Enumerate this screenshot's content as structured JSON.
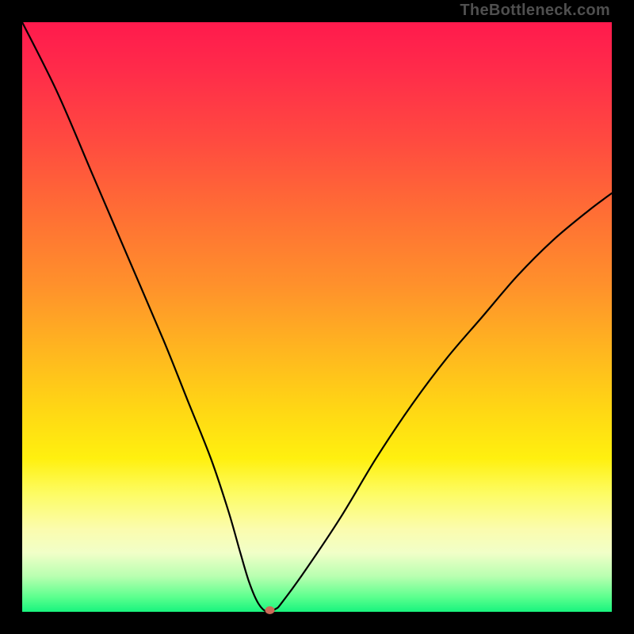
{
  "watermark": "TheBottleneck.com",
  "chart_data": {
    "type": "line",
    "title": "",
    "xlabel": "",
    "ylabel": "",
    "xlim": [
      0,
      100
    ],
    "ylim": [
      0,
      100
    ],
    "grid": false,
    "legend": false,
    "background_gradient": {
      "direction": "vertical",
      "stops": [
        {
          "pos": 0,
          "color": "#ff1a4d",
          "meaning": "bad-top"
        },
        {
          "pos": 50,
          "color": "#ffb71f",
          "meaning": "mid-orange"
        },
        {
          "pos": 72,
          "color": "#fff00f",
          "meaning": "yellow"
        },
        {
          "pos": 100,
          "color": "#18f47e",
          "meaning": "good-bottom"
        }
      ]
    },
    "series": [
      {
        "name": "bottleneck-curve",
        "x": [
          0,
          6,
          12,
          18,
          24,
          28,
          32,
          35,
          37,
          38.5,
          40,
          41.5,
          43,
          44,
          48,
          54,
          60,
          66,
          72,
          78,
          84,
          90,
          96,
          100
        ],
        "y": [
          100,
          88,
          74,
          60,
          46,
          36,
          26,
          17,
          10,
          5,
          1.5,
          0,
          0.5,
          1.5,
          7,
          16,
          26,
          35,
          43,
          50,
          57,
          63,
          68,
          71
        ]
      }
    ],
    "marker": {
      "x": 42,
      "y": 0,
      "color": "#cc6a58"
    },
    "flat_segment": {
      "x_start": 38.5,
      "x_end": 43,
      "y": 0
    }
  }
}
